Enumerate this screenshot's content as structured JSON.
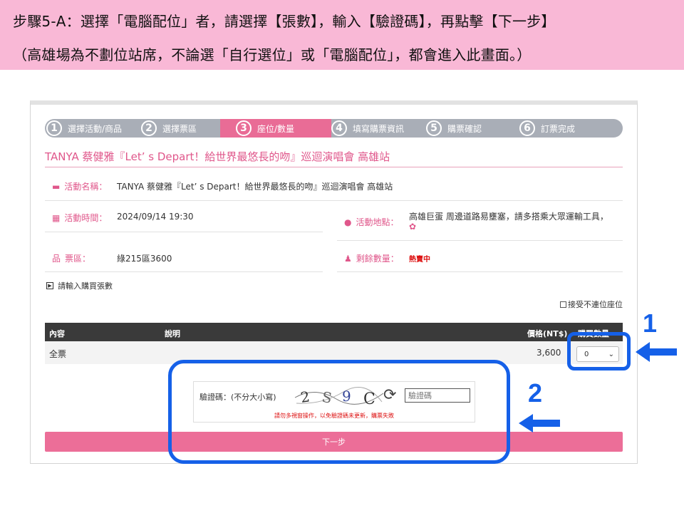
{
  "instructions": {
    "line1": "步驟5-A：選擇「電腦配位」者，請選擇【張數】，輸入【驗證碼】，再點擊【下一步】",
    "line2": "（高雄場為不劃位站席，不論選「自行選位」或「電腦配位」，都會進入此畫面。）"
  },
  "steps": [
    {
      "num": "1",
      "label": "選擇活動/商品"
    },
    {
      "num": "2",
      "label": "選擇票區"
    },
    {
      "num": "3",
      "label": "座位/數量"
    },
    {
      "num": "4",
      "label": "填寫購票資訊"
    },
    {
      "num": "5",
      "label": "購票確認"
    },
    {
      "num": "6",
      "label": "訂票完成"
    }
  ],
  "active_step": "3",
  "event_title": "TANYA 蔡健雅『Let’ s Depart！給世界最悠長的吻』巡迴演唱會 高雄站",
  "details": {
    "name_label": "活動名稱：",
    "name_value": "TANYA 蔡健雅『Let’ s Depart！給世界最悠長的吻』巡迴演唱會 高雄站",
    "time_label": "活動時間：",
    "time_value": "2024/09/14 19:30",
    "venue_label": "活動地點：",
    "venue_value": "高雄巨蛋 周邊道路易壅塞，請多搭乘大眾運輸工具，",
    "zone_label": "票區：",
    "zone_value": "綠215區3600",
    "remain_label": "剩餘數量：",
    "remain_value": "熱賣中"
  },
  "qty_hint": "請輸入購買張數",
  "accept_label": "接受不連位座位",
  "table": {
    "headers": {
      "content": "內容",
      "desc": "說明",
      "price": "價格(NT$)",
      "qty": "購買數量"
    },
    "rows": [
      {
        "content": "全票",
        "desc": "",
        "price": "3,600",
        "qty": "0"
      }
    ]
  },
  "captcha": {
    "label": "驗證碼：(不分大小寫)",
    "chars": "2S9C",
    "placeholder": "驗證碼",
    "warning": "請勿多視窗操作，以免驗證碼未更新，購票失敗"
  },
  "next_label": "下一步",
  "callouts": {
    "one": "1",
    "two": "2"
  },
  "colors": {
    "accent": "#e96c96",
    "callout": "#1560e8",
    "banner": "#f9b8d6"
  }
}
